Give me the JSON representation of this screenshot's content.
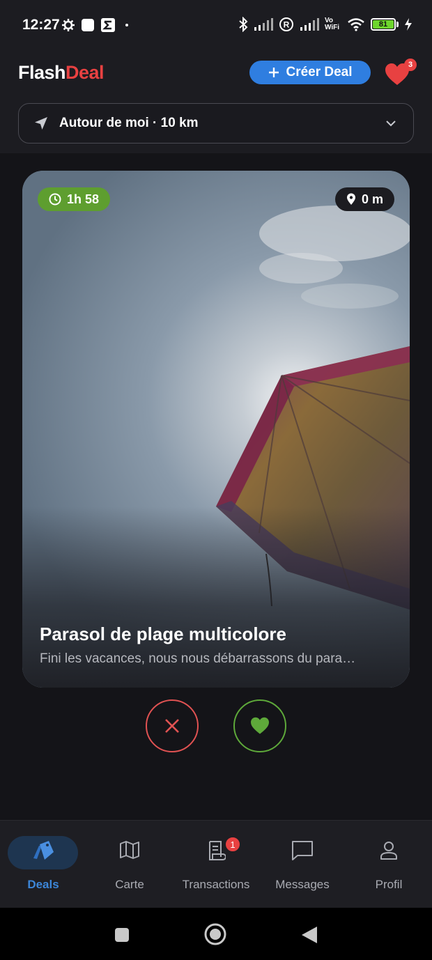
{
  "status_bar": {
    "time": "12:27",
    "wifi_label": "Vo WiFi",
    "battery": "81"
  },
  "header": {
    "logo_part1": "Flash",
    "logo_part2": "Deal",
    "create_button": "Créer Deal",
    "favorites_count": "3",
    "location_label": "Autour de moi · 10 km"
  },
  "card": {
    "timer": "1h 58",
    "distance": "0 m",
    "title": "Parasol de plage multicolore",
    "description": "Fini les vacances, nous nous débarrassons du para…"
  },
  "nav": {
    "items": [
      {
        "label": "Deals",
        "icon": "tag-icon",
        "active": true
      },
      {
        "label": "Carte",
        "icon": "map-icon"
      },
      {
        "label": "Transactions",
        "icon": "receipt-icon",
        "badge": "1"
      },
      {
        "label": "Messages",
        "icon": "message-icon"
      },
      {
        "label": "Profil",
        "icon": "user-icon"
      }
    ]
  },
  "colors": {
    "brand_red": "#e84141",
    "accent_blue": "#2f7ee0",
    "timer_green": "#5e9e2f",
    "background": "#141418"
  }
}
